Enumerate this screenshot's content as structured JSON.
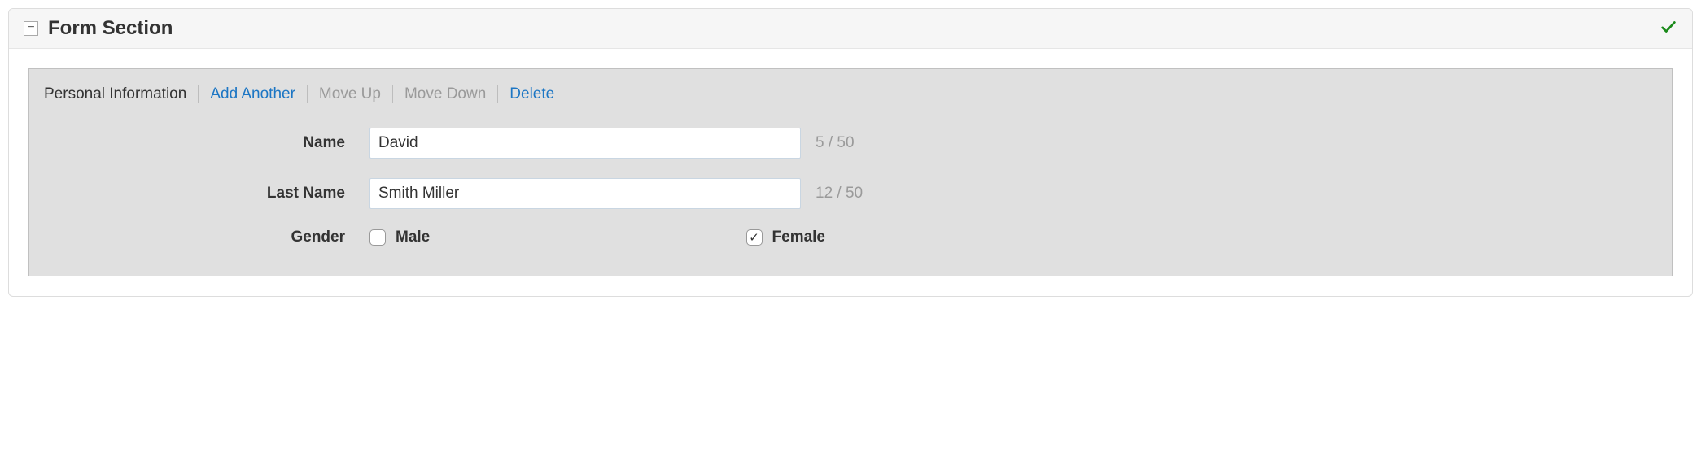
{
  "panel": {
    "title": "Form Section",
    "collapse_symbol": "−"
  },
  "tabs": {
    "title": "Personal Information",
    "add_another": "Add Another",
    "move_up": "Move Up",
    "move_down": "Move Down",
    "delete": "Delete"
  },
  "fields": {
    "name": {
      "label": "Name",
      "value": "David",
      "count": "5 / 50"
    },
    "last_name": {
      "label": "Last Name",
      "value": "Smith Miller",
      "count": "12 / 50"
    },
    "gender": {
      "label": "Gender",
      "options": {
        "male": {
          "label": "Male",
          "checked": false
        },
        "female": {
          "label": "Female",
          "checked": true
        }
      }
    }
  }
}
